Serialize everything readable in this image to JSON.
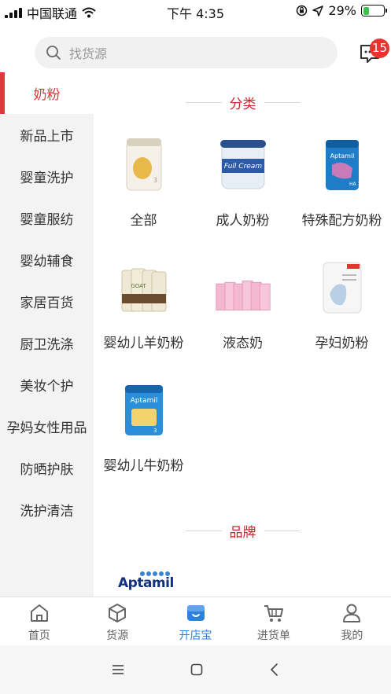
{
  "status_bar": {
    "carrier": "中国联通",
    "time": "下午 4:35",
    "battery": "29%",
    "battery_level": 0.29
  },
  "search": {
    "placeholder": "找货源"
  },
  "messages": {
    "badge_count": "15"
  },
  "sidebar": {
    "items": [
      {
        "label": "奶粉",
        "active": true
      },
      {
        "label": "新品上市"
      },
      {
        "label": "婴童洗护"
      },
      {
        "label": "婴童服纺"
      },
      {
        "label": "婴幼辅食"
      },
      {
        "label": "家居百货"
      },
      {
        "label": "厨卫洗涤"
      },
      {
        "label": "美妆个护"
      },
      {
        "label": "孕妈女性用品"
      },
      {
        "label": "防晒护肤"
      },
      {
        "label": "洗护清洁"
      }
    ]
  },
  "sections": {
    "category_title": "分类",
    "brand_title": "品牌"
  },
  "categories": [
    {
      "label": "全部",
      "icon": "gold-formula-can"
    },
    {
      "label": "成人奶粉",
      "icon": "full-cream-can"
    },
    {
      "label": "特殊配方奶粉",
      "icon": "aptamil-ha-can"
    },
    {
      "label": "婴幼儿羊奶粉",
      "icon": "goat-milk-cans"
    },
    {
      "label": "液态奶",
      "icon": "pink-milk-boxes"
    },
    {
      "label": "孕妇奶粉",
      "icon": "maternal-milk-can"
    },
    {
      "label": "婴幼儿牛奶粉",
      "icon": "aptamil-can"
    }
  ],
  "brands": [
    {
      "label": "Aptamil"
    }
  ],
  "tab_bar": {
    "tabs": [
      {
        "label": "首页",
        "icon": "home-icon"
      },
      {
        "label": "货源",
        "icon": "cube-icon"
      },
      {
        "label": "开店宝",
        "icon": "store-icon",
        "active": true
      },
      {
        "label": "进货单",
        "icon": "cart-icon"
      },
      {
        "label": "我的",
        "icon": "user-icon"
      }
    ]
  },
  "colors": {
    "accent_red": "#e2363f",
    "tab_active_blue": "#2d7fe0",
    "badge_red": "#e8342f"
  }
}
